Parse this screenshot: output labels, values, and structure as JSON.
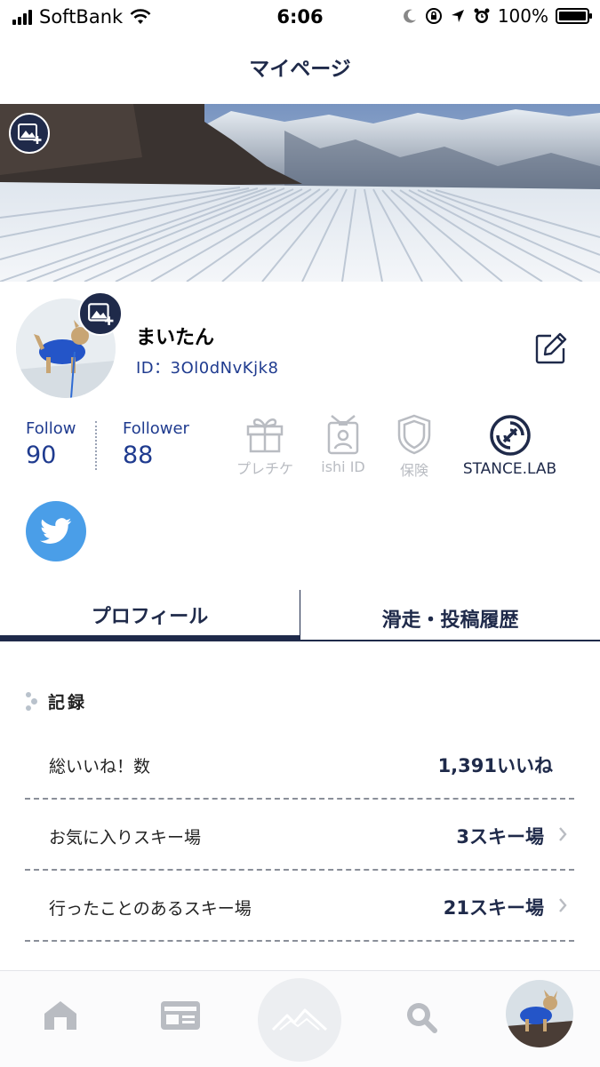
{
  "status_bar": {
    "carrier": "SoftBank",
    "time": "6:06",
    "battery_percent": "100%",
    "battery_level": 1.0,
    "icons": [
      "signal-icon",
      "wifi-icon",
      "moon-icon",
      "orientation-lock-icon",
      "location-arrow-icon",
      "alarm-icon",
      "battery-icon"
    ]
  },
  "header": {
    "title": "マイページ"
  },
  "profile": {
    "name": "まいたん",
    "id_text": "ID：3Ol0dNvKjk8"
  },
  "stats": {
    "follow_label": "Follow",
    "follow_count": "90",
    "follower_label": "Follower",
    "follower_count": "88"
  },
  "features": [
    {
      "label": "プレチケ",
      "icon": "gift-icon",
      "enabled": false
    },
    {
      "label": "ishi ID",
      "icon": "id-badge-icon",
      "enabled": false
    },
    {
      "label": "保険",
      "icon": "shield-icon",
      "enabled": false
    },
    {
      "label": "STANCE.LAB",
      "icon": "stance-lab-icon",
      "enabled": true
    }
  ],
  "tabs": [
    {
      "label": "プロフィール",
      "active": true
    },
    {
      "label": "滑走・投稿履歴",
      "active": false
    }
  ],
  "records": {
    "section_title": "記録",
    "rows": [
      {
        "label": "総いいね！数",
        "value": "1,391いいね"
      },
      {
        "label": "お気に入りスキー場",
        "value": "3スキー場"
      },
      {
        "label": "行ったことのあるスキー場",
        "value": "21スキー場"
      }
    ]
  },
  "bottom_nav": [
    "home-icon",
    "card-icon",
    "mountain-icon",
    "search-icon",
    "avatar"
  ],
  "colors": {
    "navy": "#1f2a4a",
    "id_blue": "#1f3b8f",
    "twitter": "#4a9ee8",
    "disabled_gray": "#b9bcc2"
  }
}
